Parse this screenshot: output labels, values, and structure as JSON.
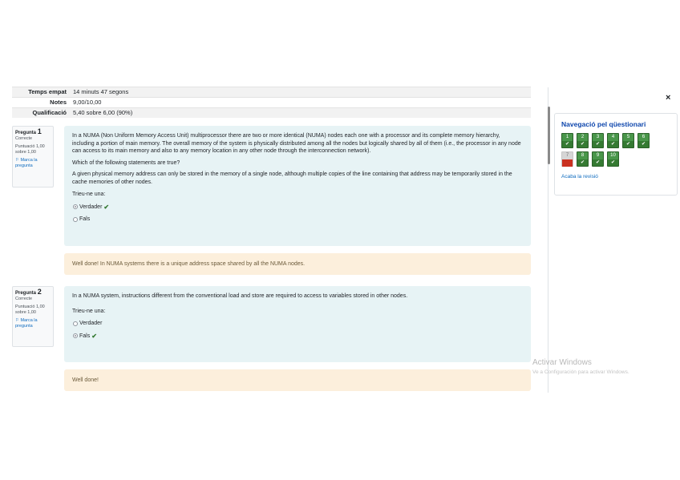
{
  "summary": {
    "rows": [
      {
        "label": "Temps empat",
        "value": "14 minuts 47 segons"
      },
      {
        "label": "Notes",
        "value": "9,00/10,00"
      },
      {
        "label": "Qualificació",
        "value": "5,40 sobre 6,00 (90%)"
      }
    ]
  },
  "questions": [
    {
      "number_label": "Pregunta",
      "number": "1",
      "status": "Correcte",
      "score": "Puntuació 1,00 sobre 1,00",
      "flag": "Marca la pregunta",
      "text": "In a NUMA (Non Uniform Memory Access Unit) multiprocessor there are two or more identical (NUMA) nodes each one with a processor and its complete memory hierarchy, including a portion of main memory. The overall memory of the system is physically distributed among all the nodes but logically shared by all of them (i.e., the processor in any node can access to its main memory and also to any memory location in any other node through the interconnection network).",
      "prompt": "Which of the following statements are true?",
      "statement": "A given physical memory address can only be stored in the memory of a single node, although multiple copies of the line containing that address may be temporarily stored in the cache memories of other nodes.",
      "answer_label": "Trieu-ne una:",
      "options": [
        {
          "label": "Verdader",
          "selected": true,
          "correct": true
        },
        {
          "label": "Fals",
          "selected": false,
          "correct": false
        }
      ],
      "feedback": "Well done! In NUMA systems there is a unique address space shared by all the NUMA nodes."
    },
    {
      "number_label": "Pregunta",
      "number": "2",
      "status": "Correcte",
      "score": "Puntuació 1,00 sobre 1,00",
      "flag": "Marca la pregunta",
      "text": "In a NUMA system, instructions different from the conventional load and store are required to access to variables stored in other nodes.",
      "answer_label": "Trieu-ne una:",
      "options": [
        {
          "label": "Verdader",
          "selected": false,
          "correct": false
        },
        {
          "label": "Fals",
          "selected": true,
          "correct": true
        }
      ],
      "feedback": "Well done!"
    }
  ],
  "drawer": {
    "close": "×",
    "nav_title": "Navegació pel qüestionari",
    "buttons": [
      {
        "num": "1",
        "state": "correct",
        "mark": "✔"
      },
      {
        "num": "2",
        "state": "correct",
        "mark": "✔"
      },
      {
        "num": "3",
        "state": "correct",
        "mark": "✔"
      },
      {
        "num": "4",
        "state": "correct",
        "mark": "✔"
      },
      {
        "num": "5",
        "state": "correct",
        "mark": "✔"
      },
      {
        "num": "6",
        "state": "correct",
        "mark": "✔"
      },
      {
        "num": "7",
        "state": "wrong",
        "mark": ""
      },
      {
        "num": "8",
        "state": "correct",
        "mark": "✔"
      },
      {
        "num": "9",
        "state": "correct",
        "mark": "✔"
      },
      {
        "num": "10",
        "state": "correct",
        "mark": "✔"
      }
    ],
    "finish_link": "Acaba la revisió"
  },
  "watermark": {
    "title": "Activar Windows",
    "subtitle": "Ve a Configuración para activar Windows."
  },
  "colors": {
    "correct": "#357a32",
    "incorrect": "#ca3120",
    "content_bg": "#e7f3f5",
    "feedback_bg": "#fcefdc",
    "link": "#0f6cbf"
  }
}
